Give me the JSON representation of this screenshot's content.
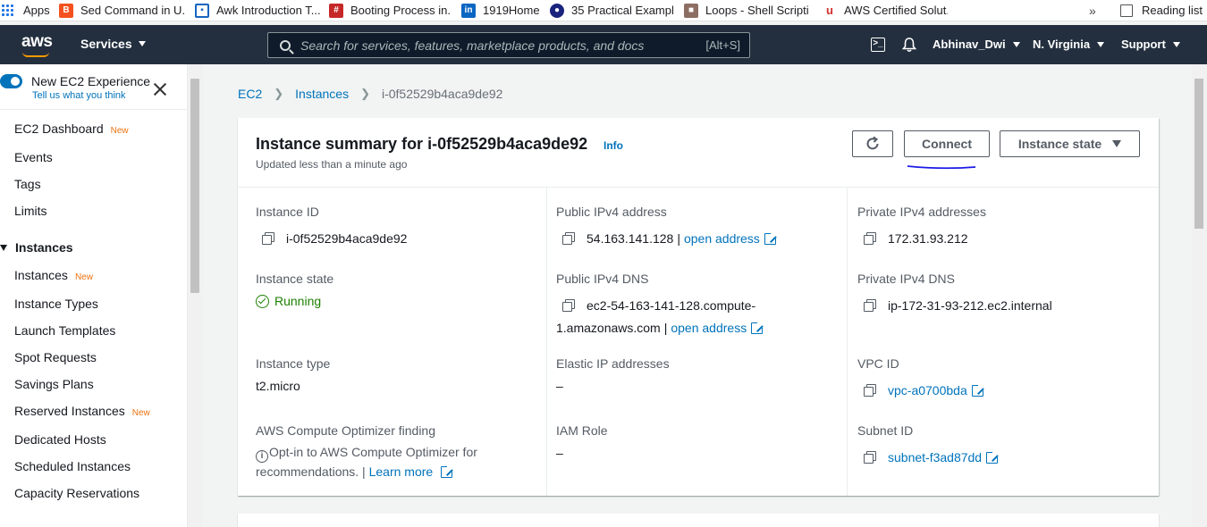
{
  "bookmarks": {
    "apps": "Apps",
    "items": [
      "Sed Command in U...",
      "Awk Introduction T...",
      "Booting Process in...",
      "1919Home",
      "35 Practical Exampl...",
      "Loops - Shell Scripti...",
      "AWS Certified Solut..."
    ],
    "more": "»",
    "reading_list": "Reading list",
    "colors": [
      "#f4511e",
      "#1565c0",
      "#c62828",
      "#0a66c2",
      "#1a237e",
      "#8d6e63",
      "#d32f2f"
    ]
  },
  "topnav": {
    "logo": "aws",
    "services": "Services",
    "search_placeholder": "Search for services, features, marketplace products, and docs",
    "shortcut": "[Alt+S]",
    "user": "Abhinav_Dwi",
    "region": "N. Virginia",
    "support": "Support"
  },
  "sidebar": {
    "new_experience": "New EC2 Experience",
    "tell_us": "Tell us what you think",
    "new_badge": "New",
    "items": [
      {
        "label": "EC2 Dashboard",
        "badge": "New"
      },
      {
        "label": "Events"
      },
      {
        "label": "Tags"
      },
      {
        "label": "Limits"
      }
    ],
    "section": "Instances",
    "section_items": [
      {
        "label": "Instances",
        "badge": "New"
      },
      {
        "label": "Instance Types"
      },
      {
        "label": "Launch Templates"
      },
      {
        "label": "Spot Requests"
      },
      {
        "label": "Savings Plans"
      },
      {
        "label": "Reserved Instances",
        "badge": "New"
      },
      {
        "label": "Dedicated Hosts"
      },
      {
        "label": "Scheduled Instances"
      },
      {
        "label": "Capacity Reservations"
      }
    ]
  },
  "breadcrumb": {
    "root": "EC2",
    "parent": "Instances",
    "current": "i-0f52529b4aca9de92"
  },
  "summary": {
    "title": "Instance summary for i-0f52529b4aca9de92",
    "info": "Info",
    "updated": "Updated less than a minute ago",
    "connect": "Connect",
    "instance_state_btn": "Instance state",
    "fields": {
      "instance_id_label": "Instance ID",
      "instance_id": "i-0f52529b4aca9de92",
      "public_ipv4_label": "Public IPv4 address",
      "public_ipv4": "54.163.141.128",
      "open_address": "open address",
      "private_ipv4_label": "Private IPv4 addresses",
      "private_ipv4": "172.31.93.212",
      "state_label": "Instance state",
      "state": "Running",
      "public_dns_label": "Public IPv4 DNS",
      "public_dns_line1": "ec2-54-163-141-128.compute-",
      "public_dns_line2": "1.amazonaws.com",
      "private_dns_label": "Private IPv4 DNS",
      "private_dns": "ip-172-31-93-212.ec2.internal",
      "type_label": "Instance type",
      "type": "t2.micro",
      "elastic_label": "Elastic IP addresses",
      "elastic": "–",
      "vpc_label": "VPC ID",
      "vpc": "vpc-a0700bda",
      "optimizer_label": "AWS Compute Optimizer finding",
      "optimizer_text": "Opt-in to AWS Compute Optimizer for recommendations. |",
      "learn_more": "Learn more",
      "iam_label": "IAM Role",
      "iam": "–",
      "subnet_label": "Subnet ID",
      "subnet": "subnet-f3ad87dd"
    }
  },
  "colors": {
    "nav_bg": "#232f3e",
    "link": "#0073bb",
    "running": "#1d8102",
    "new_badge": "#ec7211"
  }
}
